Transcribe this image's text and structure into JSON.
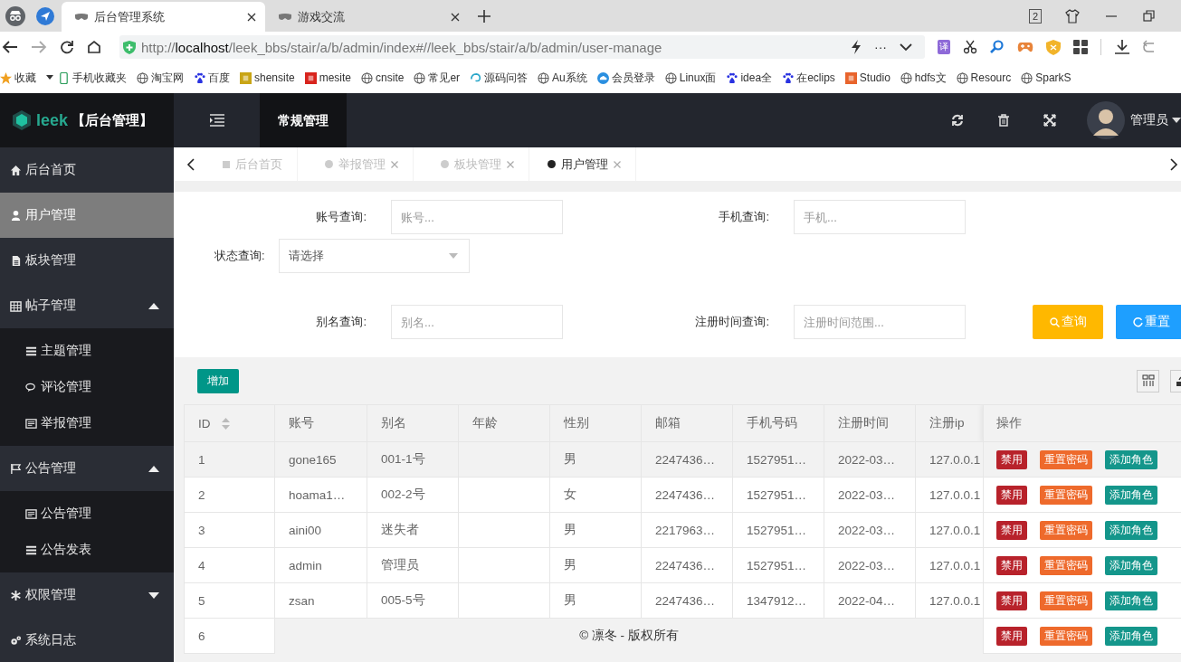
{
  "browser": {
    "tabs": [
      {
        "title": "后台管理系统",
        "selected": true
      },
      {
        "title": "游戏交流",
        "selected": false
      }
    ],
    "window_count": "2",
    "address": {
      "url": "http://**localhost**/leek_bbs/stair/a/b/admin/index#//leek_bbs/stair/a/b/admin/user-manage"
    },
    "more": "···",
    "translate_badge": "译",
    "bookmarks_menu": "收藏",
    "bookmarks": [
      {
        "label": "手机收藏夹",
        "kind": "phone"
      },
      {
        "label": "淘宝网",
        "kind": "globe"
      },
      {
        "label": "百度",
        "kind": "paw"
      },
      {
        "label": "shensite",
        "kind": "square-green"
      },
      {
        "label": "mesite",
        "kind": "square-red"
      },
      {
        "label": "cnsite",
        "kind": "globe"
      },
      {
        "label": "常见er",
        "kind": "globe"
      },
      {
        "label": "源码问答",
        "kind": "swirl"
      },
      {
        "label": "Au系统",
        "kind": "globe"
      },
      {
        "label": "会员登录",
        "kind": "cloud"
      },
      {
        "label": "Linux面",
        "kind": "globe"
      },
      {
        "label": "idea全",
        "kind": "paw"
      },
      {
        "label": "在eclips",
        "kind": "paw"
      },
      {
        "label": "Studio",
        "kind": "square-orange"
      },
      {
        "label": "hdfs文",
        "kind": "globe"
      },
      {
        "label": "Resourc",
        "kind": "globe"
      },
      {
        "label": "SparkS",
        "kind": "globe"
      }
    ]
  },
  "header": {
    "logo_text": "leek",
    "title": "【后台管理】",
    "nav": [
      {
        "label": "常规管理",
        "selected": true
      }
    ],
    "user": "管理员"
  },
  "sidebar": {
    "items": [
      {
        "label": "后台首页",
        "kind": "home",
        "selected": false
      },
      {
        "label": "用户管理",
        "kind": "user",
        "selected": true
      },
      {
        "label": "板块管理",
        "kind": "file",
        "selected": false
      },
      {
        "label": "帖子管理",
        "kind": "calendar",
        "selected": false,
        "expanded": true,
        "children": [
          {
            "label": "主题管理",
            "kind": "bars",
            "selected": false
          },
          {
            "label": "评论管理",
            "kind": "comments",
            "selected": false
          },
          {
            "label": "举报管理",
            "kind": "card",
            "selected": false
          }
        ]
      },
      {
        "label": "公告管理",
        "kind": "flag",
        "selected": false,
        "expanded": true,
        "children": [
          {
            "label": "公告管理",
            "kind": "card",
            "selected": false
          },
          {
            "label": "公告发表",
            "kind": "bars",
            "selected": false
          }
        ]
      },
      {
        "label": "权限管理",
        "kind": "snowflake",
        "selected": false,
        "expanded": false
      },
      {
        "label": "系统日志",
        "kind": "gears",
        "selected": false
      }
    ]
  },
  "page_tabs": [
    {
      "label": "后台首页",
      "kind": "home",
      "selected": false,
      "closable": false
    },
    {
      "label": "举报管理",
      "kind": "page",
      "selected": false,
      "closable": true
    },
    {
      "label": "板块管理",
      "kind": "page",
      "selected": false,
      "closable": true
    },
    {
      "label": "用户管理",
      "kind": "page",
      "selected": true,
      "closable": true
    }
  ],
  "search": {
    "fields": [
      {
        "label": "账号查询:",
        "placeholder": "账号...",
        "kind": "input"
      },
      {
        "label": "手机查询:",
        "placeholder": "手机...",
        "kind": "input"
      },
      {
        "label": "状态查询:",
        "placeholder": "请选择",
        "kind": "select"
      },
      {
        "label": "别名查询:",
        "placeholder": "别名...",
        "kind": "input"
      },
      {
        "label": "注册时间查询:",
        "placeholder": "注册时间范围...",
        "kind": "input"
      }
    ],
    "buttons": [
      {
        "label": "查询",
        "kind": "search"
      },
      {
        "label": "重置",
        "kind": "reset"
      }
    ]
  },
  "toolbar": {
    "add_button": "增加"
  },
  "table": {
    "columns": [
      "ID",
      "账号",
      "别名",
      "年龄",
      "性别",
      "邮箱",
      "手机号码",
      "注册时间",
      "注册ip",
      "操作"
    ],
    "rows": [
      {
        "selected": true,
        "cells": [
          "1",
          "gone165",
          "001-1号",
          "",
          "男",
          "2247436…",
          "1527951…",
          "2022-03…",
          "127.0.0.1"
        ],
        "actions": [
          "禁用",
          "重置密码",
          "添加角色"
        ]
      },
      {
        "selected": false,
        "cells": [
          "2",
          "hoama1…",
          "002-2号",
          "",
          "女",
          "2247436…",
          "1527951…",
          "2022-03…",
          "127.0.0.1"
        ],
        "actions": [
          "禁用",
          "重置密码",
          "添加角色"
        ]
      },
      {
        "selected": false,
        "cells": [
          "3",
          "aini00",
          "迷失者",
          "",
          "男",
          "2217963…",
          "1527951…",
          "2022-03…",
          "127.0.0.1"
        ],
        "actions": [
          "禁用",
          "重置密码",
          "添加角色"
        ]
      },
      {
        "selected": false,
        "cells": [
          "4",
          "admin",
          "管理员",
          "",
          "男",
          "2247436…",
          "1527951…",
          "2022-03…",
          "127.0.0.1"
        ],
        "actions": [
          "禁用",
          "重置密码",
          "添加角色"
        ]
      },
      {
        "selected": false,
        "cells": [
          "5",
          "zsan",
          "005-5号",
          "",
          "男",
          "2247436…",
          "1347912…",
          "2022-04…",
          "127.0.0.1"
        ],
        "actions": [
          "禁用",
          "重置密码",
          "添加角色"
        ]
      },
      {
        "selected": false,
        "cells": [
          "6"
        ],
        "actions": [
          "禁用",
          "重置密码",
          "添加角色"
        ]
      }
    ]
  },
  "footer": "© 凛冬 - 版权所有"
}
